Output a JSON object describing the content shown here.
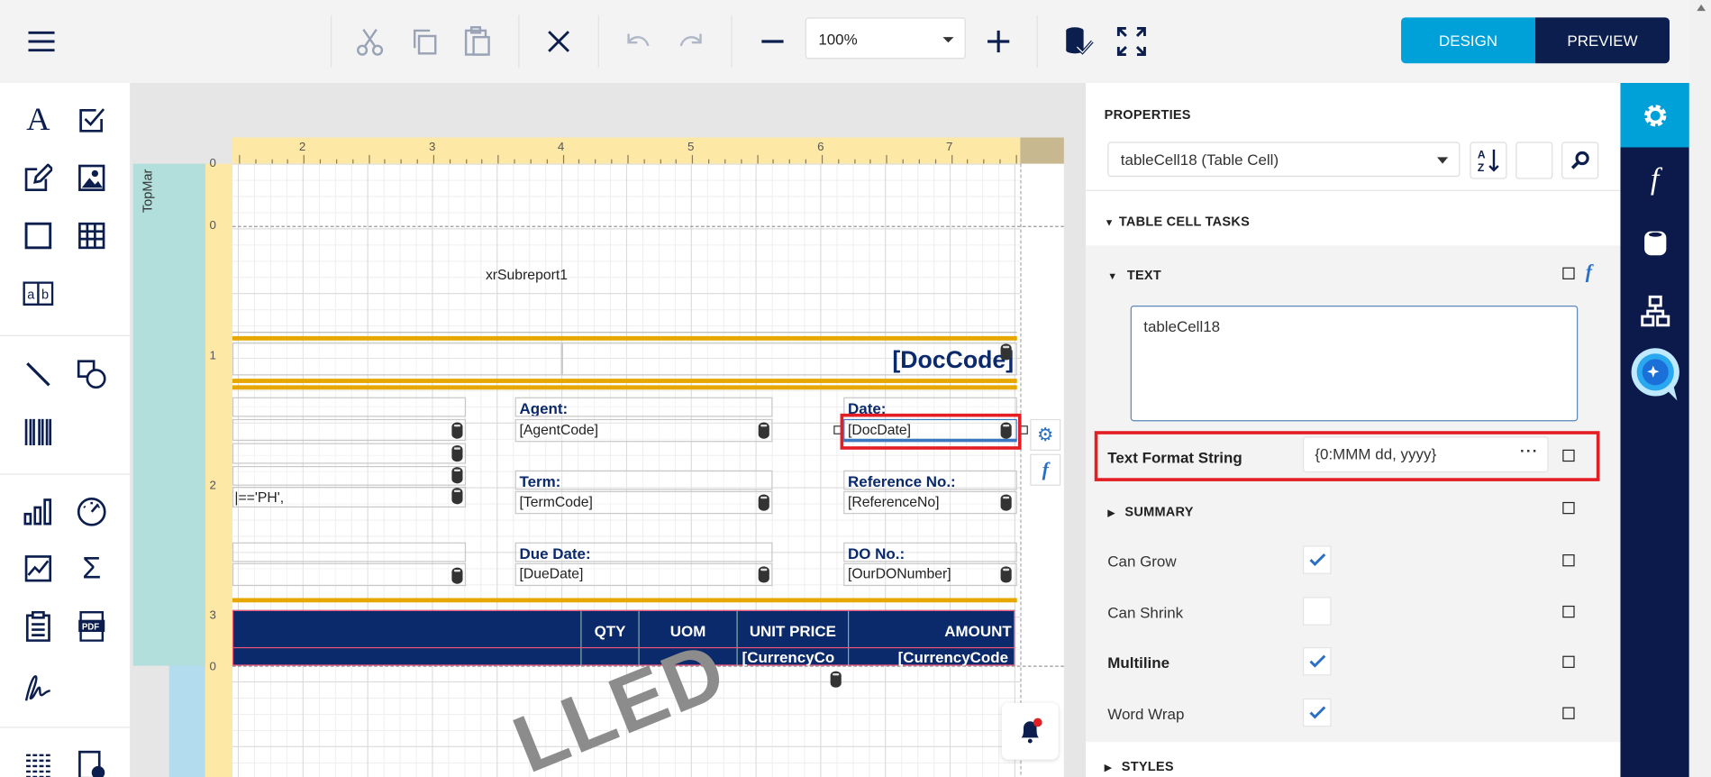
{
  "toolbar": {
    "zoom_value": "100%",
    "design_label": "DESIGN",
    "preview_label": "PREVIEW"
  },
  "canvas": {
    "ruler_numbers": [
      "2",
      "3",
      "4",
      "5",
      "6",
      "7"
    ],
    "vruler_numbers": [
      "0",
      "0",
      "1",
      "2",
      "3",
      "0"
    ],
    "top_margin_label": "TopMar",
    "subreport": "xrSubreport1",
    "doc_code": "[DocCode]",
    "left_expr": "|=='PH',",
    "fields": {
      "agent_label": "Agent:",
      "agent_value": "[AgentCode]",
      "term_label": "Term:",
      "term_value": "[TermCode]",
      "due_label": "Due Date:",
      "due_value": "[DueDate]",
      "date_label": "Date:",
      "date_value": "[DocDate]",
      "ref_label": "Reference No.:",
      "ref_value": "[ReferenceNo]",
      "do_label": "DO No.:",
      "do_value": "[OurDONumber]"
    },
    "table_headers": [
      "",
      "QTY",
      "UOM",
      "UNIT PRICE",
      "AMOUNT"
    ],
    "table_row": [
      "",
      "",
      "",
      "[CurrencyCo",
      "[CurrencyCode"
    ],
    "watermark": "LLED"
  },
  "properties": {
    "title": "PROPERTIES",
    "selected_component": "tableCell18 (Table Cell)",
    "tasks_header": "TABLE CELL TASKS",
    "text_header": "TEXT",
    "text_value": "tableCell18",
    "format_label": "Text Format String",
    "format_value": "{0:MMM dd, yyyy}",
    "summary_header": "SUMMARY",
    "rows": [
      {
        "label": "Can Grow",
        "checked": true
      },
      {
        "label": "Can Shrink",
        "checked": false
      },
      {
        "label": "Multiline",
        "checked": true
      },
      {
        "label": "Word Wrap",
        "checked": true
      }
    ],
    "styles_header": "STYLES"
  },
  "colors": {
    "accent": "#00a0d9",
    "navy": "#0b1e4d",
    "highlight": "#e31e24",
    "band": "#e6a800"
  }
}
